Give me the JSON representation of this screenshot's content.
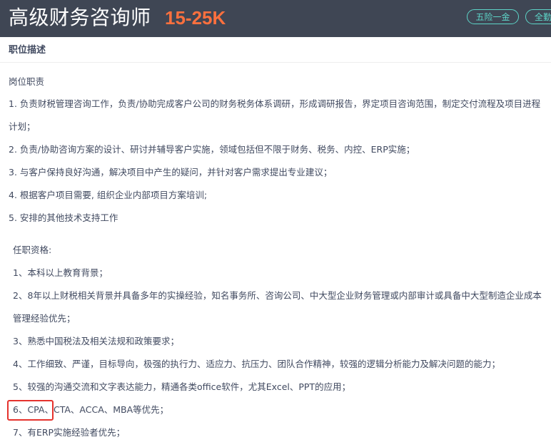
{
  "header": {
    "job_title": "高级财务咨询师",
    "salary": "15-25K",
    "tags": [
      "五险一金",
      "全勤奖"
    ]
  },
  "section": {
    "title": "职位描述"
  },
  "responsibilities": {
    "heading": "岗位职责",
    "lines": [
      "1. 负责财税管理咨询工作，负责/协助完成客户公司的财务税务体系调研，形成调研报告，界定项目咨询范围，制定交付流程及项目进程",
      "计划；",
      "2. 负责/协助咨询方案的设计、研讨并辅导客户实施，领域包括但不限于财务、税务、内控、ERP实施；",
      "3. 与客户保持良好沟通，解决项目中产生的疑问，并针对客户需求提出专业建议；",
      "4. 根据客户项目需要, 组织企业内部项目方案培训;",
      "5. 安排的其他技术支持工作"
    ]
  },
  "qualifications": {
    "heading": "任职资格:",
    "lines": [
      "1、本科以上教育背景；",
      "2、8年以上财税相关背景并具备多年的实操经验，知名事务所、咨询公司、中大型企业财务管理或内部审计或具备中大型制造企业成本",
      "管理经验优先；",
      "3、熟悉中国税法及相关法规和政策要求；",
      "4、工作细致、严谨，目标导向，极强的执行力、适应力、抗压力、团队合作精神，较强的逻辑分析能力及解决问题的能力；",
      "5、较强的沟通交流和文字表达能力，精通各类office软件，尤其Excel、PPT的应用；",
      "6、CPA、CTA、ACCA、MBA等优先；",
      "7、有ERP实施经验者优先；"
    ]
  },
  "colors": {
    "header_bg": "#3f4654",
    "salary": "#fc703e",
    "tag": "#5dd5c8",
    "body_text": "#414a60",
    "annotation": "#e5322d"
  }
}
